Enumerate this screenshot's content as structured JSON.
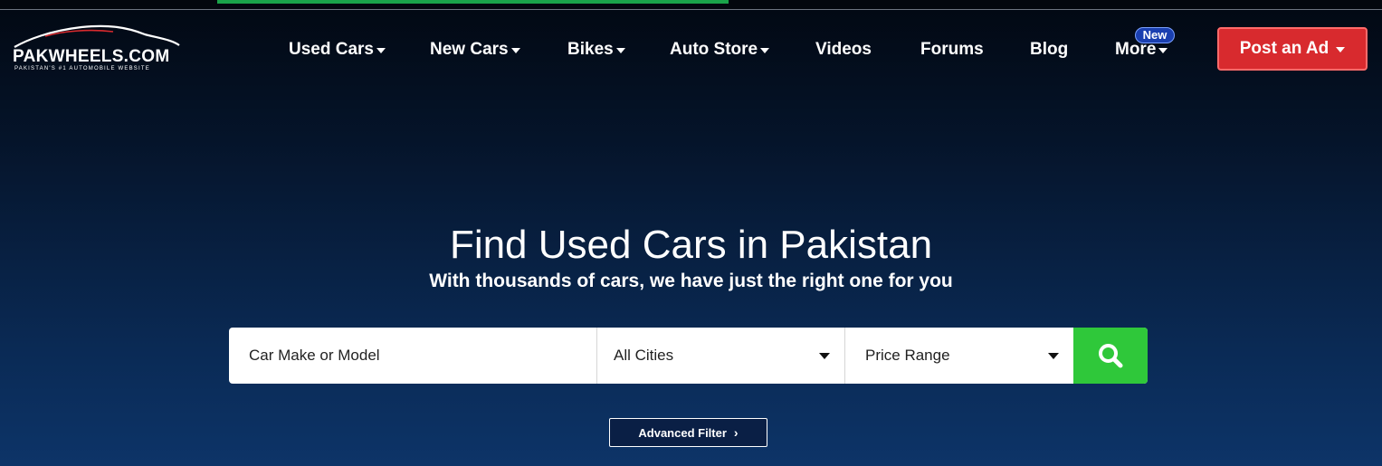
{
  "brand": {
    "logo_text": "PAKWHEELS.COM",
    "tagline": "PAKISTAN'S #1 AUTOMOBILE WEBSITE"
  },
  "nav": {
    "items": [
      {
        "label": "Used Cars",
        "dropdown": true
      },
      {
        "label": "New Cars",
        "dropdown": true
      },
      {
        "label": "Bikes",
        "dropdown": true
      },
      {
        "label": "Auto Store",
        "dropdown": true
      },
      {
        "label": "Videos",
        "dropdown": false
      },
      {
        "label": "Forums",
        "dropdown": false
      },
      {
        "label": "Blog",
        "dropdown": false
      },
      {
        "label": "More",
        "dropdown": true
      }
    ],
    "new_badge": "New",
    "post_ad_label": "Post an Ad"
  },
  "hero": {
    "title": "Find Used Cars in Pakistan",
    "subtitle": "With thousands of cars, we have just the right one for you"
  },
  "search": {
    "model_placeholder": "Car Make or Model",
    "city_value": "All Cities",
    "price_value": "Price Range",
    "button_icon": "search-icon",
    "advanced_filter_label": "Advanced Filter"
  },
  "colors": {
    "post_ad": "#d82a2e",
    "search_button": "#2fc83a",
    "new_badge": "#1a3fb0",
    "background_top": "#020812",
    "background_bottom": "#0d3468"
  }
}
